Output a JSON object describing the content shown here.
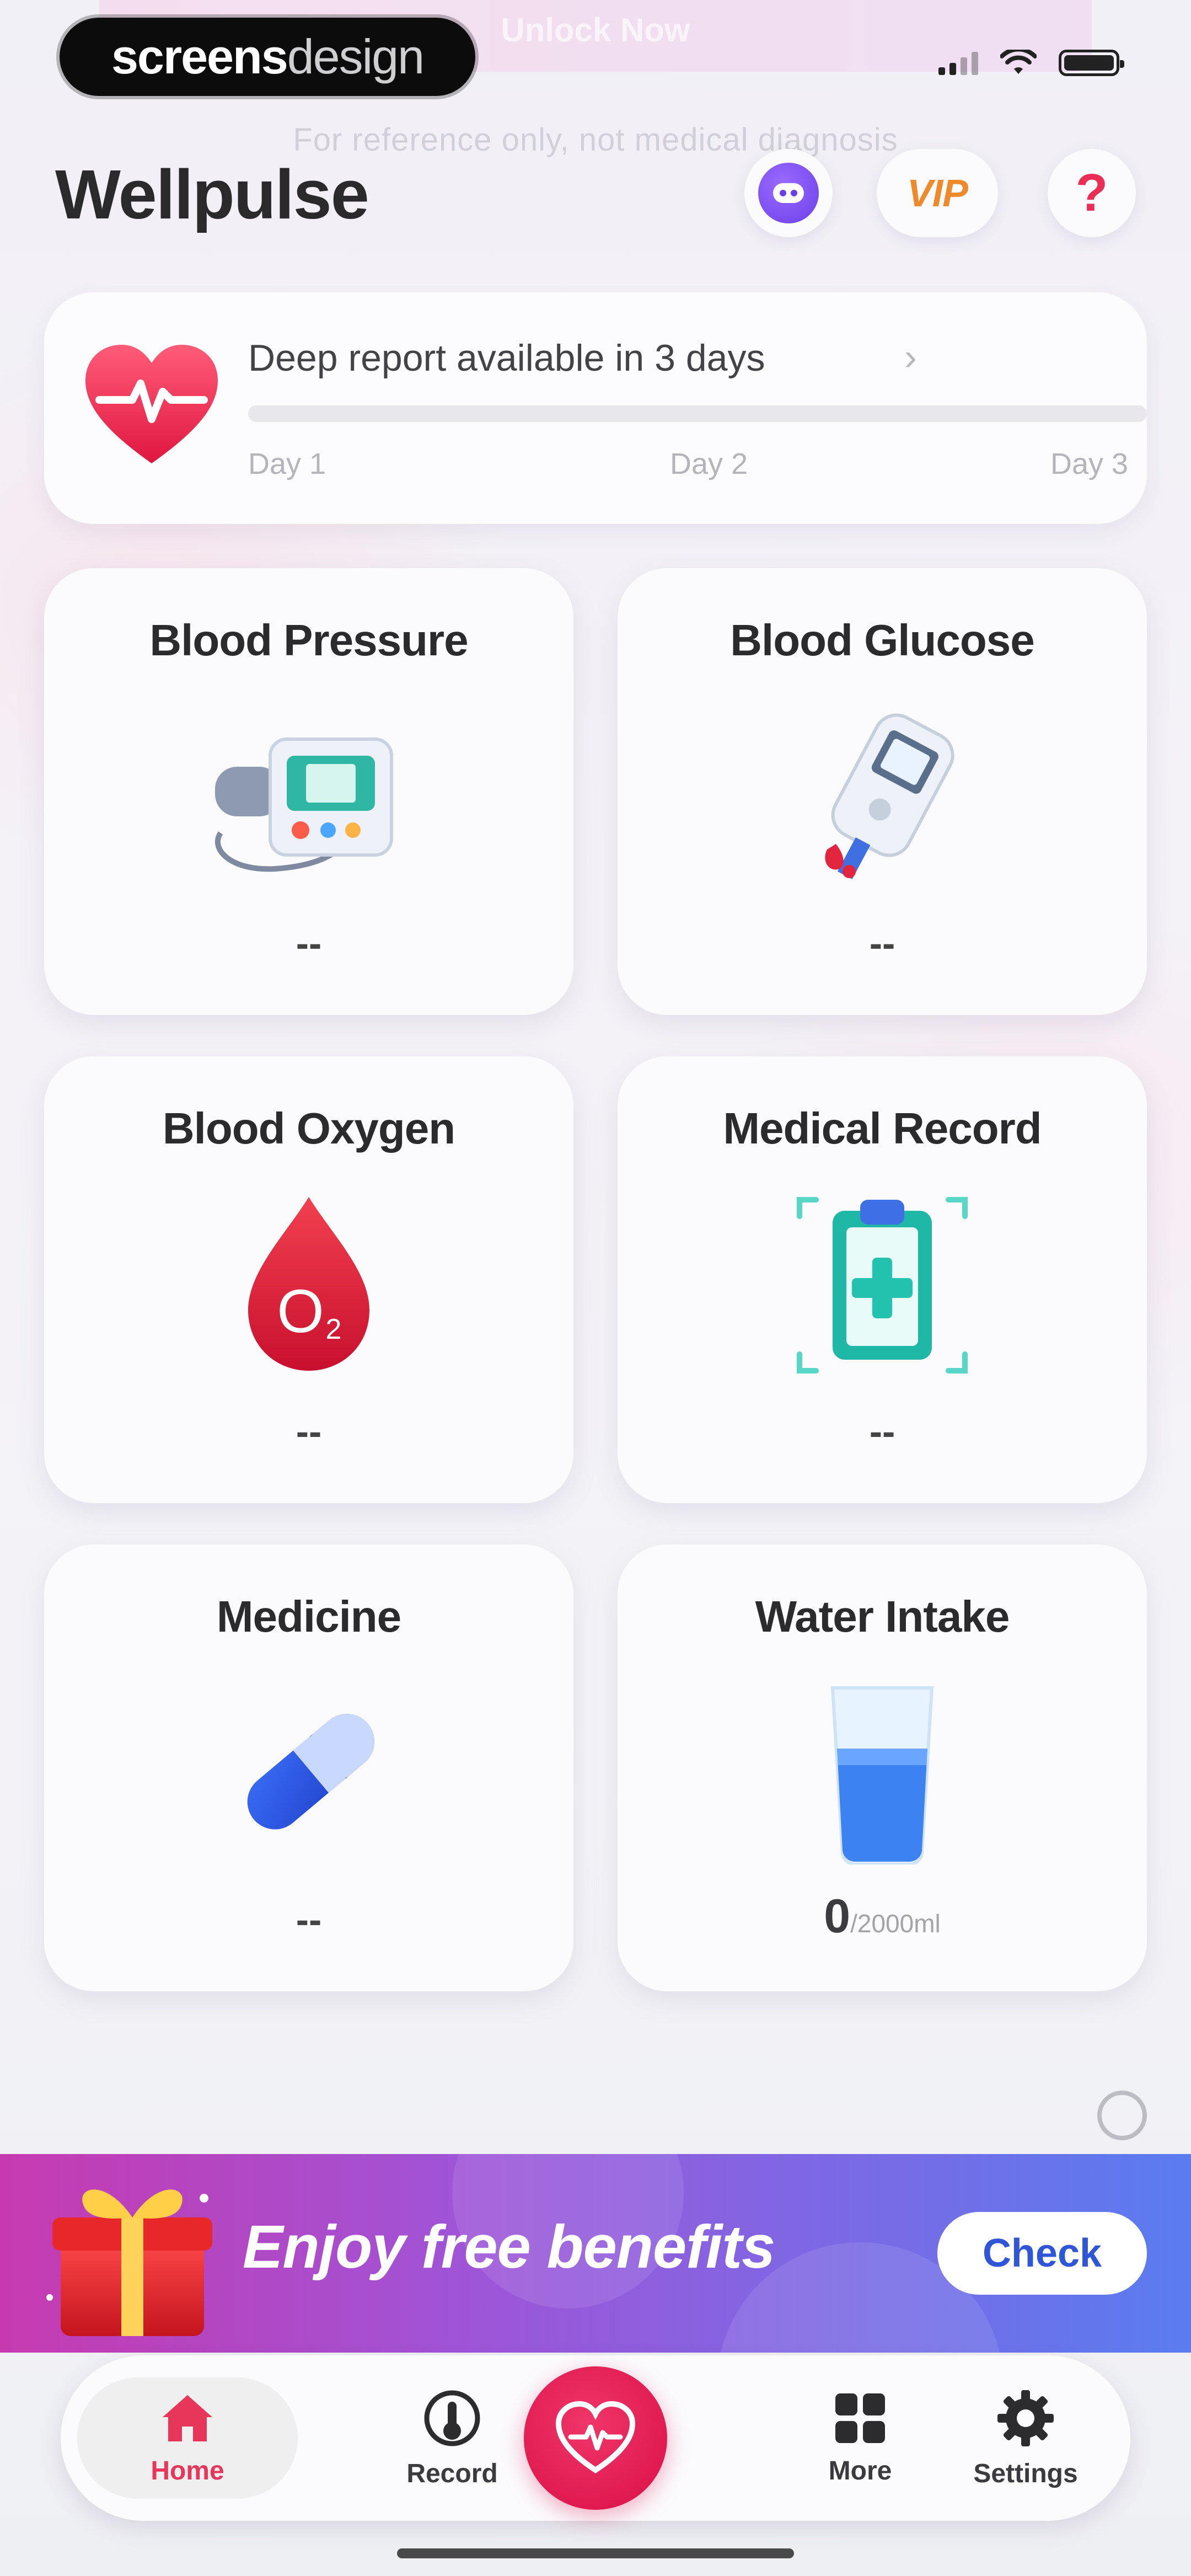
{
  "watermark": {
    "part1": "screens",
    "part2": "design"
  },
  "ghost": {
    "banner": "Unlock Now",
    "disclaimer": "For reference only, not medical diagnosis"
  },
  "app": {
    "title": "Wellpulse"
  },
  "header": {
    "vip_label": "VIP",
    "help_label": "?"
  },
  "report": {
    "title": "Deep report available in 3 days",
    "progress": 0.0,
    "days": [
      "Day 1",
      "Day 2",
      "Day 3"
    ]
  },
  "tiles": [
    {
      "title": "Blood Pressure",
      "value": "--",
      "icon": "blood-pressure-monitor-icon"
    },
    {
      "title": "Blood Glucose",
      "value": "--",
      "icon": "glucose-meter-icon"
    },
    {
      "title": "Blood Oxygen",
      "value": "--",
      "icon": "oxygen-drop-icon"
    },
    {
      "title": "Medical Record",
      "value": "--",
      "icon": "clipboard-medical-icon"
    },
    {
      "title": "Medicine",
      "value": "--",
      "icon": "pill-capsule-icon"
    },
    {
      "title": "Water Intake",
      "value": "0",
      "goal": "/2000ml",
      "icon": "water-glass-icon"
    }
  ],
  "promo": {
    "text": "Enjoy free benefits",
    "button": "Check"
  },
  "tabs": [
    {
      "label": "Home",
      "icon": "home-icon",
      "active": true
    },
    {
      "label": "Record",
      "icon": "record-icon"
    },
    {
      "label": "More",
      "icon": "grid-icon"
    },
    {
      "label": "Settings",
      "icon": "gear-icon"
    }
  ],
  "colors": {
    "accent": "#E8365B",
    "promo_start": "#C63AB0",
    "promo_end": "#5A7CF0",
    "check_text": "#2F55D8",
    "vip": "#EE8A2A"
  }
}
